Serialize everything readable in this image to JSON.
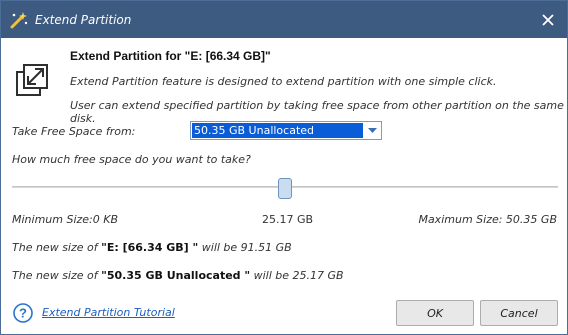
{
  "window": {
    "title": "Extend Partition",
    "title_icon": "wand-icon",
    "close_icon": "close-icon"
  },
  "header": {
    "icon": "expand-arrows-icon",
    "title": "Extend Partition for \"E: [66.34 GB]\"",
    "line1": "Extend Partition feature is designed to extend partition with one simple click.",
    "line2": "User can extend specified partition by taking free space from other partition on the same disk."
  },
  "take_from": {
    "label": "Take Free Space from:",
    "selected": "50.35 GB Unallocated"
  },
  "slider": {
    "label": "How much free space do you want to take?",
    "value_fraction": 0.5,
    "min_label": "Minimum Size:0 KB",
    "current_label": "25.17 GB",
    "max_label": "Maximum Size: 50.35 GB"
  },
  "results": {
    "line1_prefix": "The new size of ",
    "line1_name": "\"E: [66.34 GB] \"",
    "line1_suffix": " will be 91.51 GB",
    "line2_prefix": "The new size of ",
    "line2_name": "\"50.35 GB Unallocated \"",
    "line2_suffix": " will be 25.17 GB"
  },
  "footer": {
    "help_icon": "help-icon",
    "tutorial_link": "Extend Partition Tutorial",
    "ok_label": "OK",
    "cancel_label": "Cancel"
  },
  "colors": {
    "titlebar": "#3d5a80",
    "selection": "#0b5cd7",
    "link": "#1d5fbf"
  }
}
